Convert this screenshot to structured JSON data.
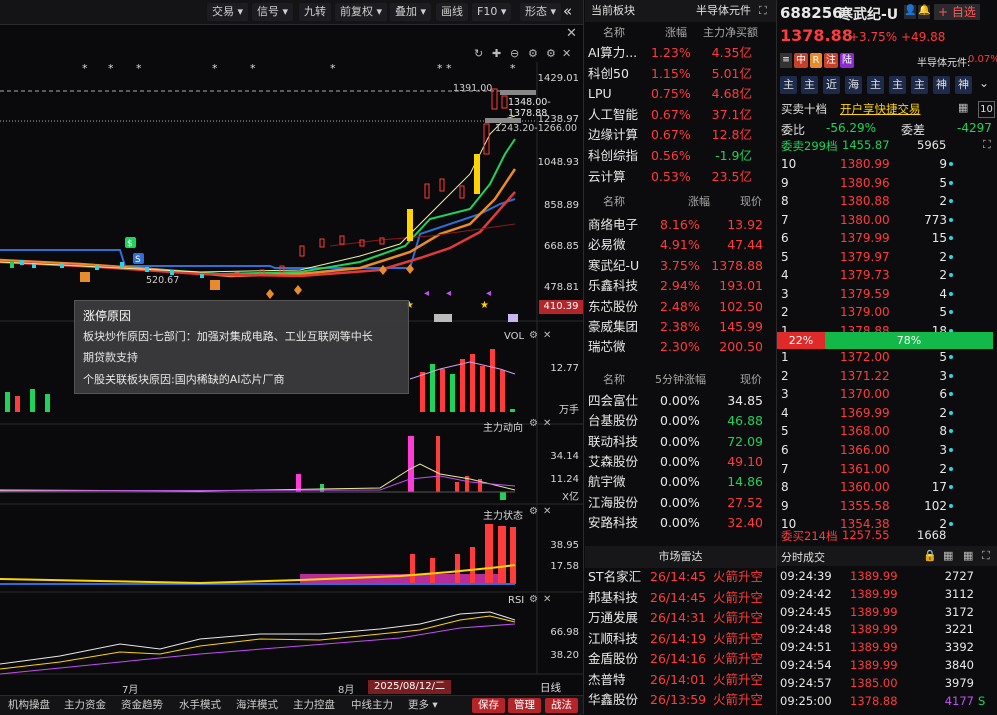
{
  "toolbar": {
    "items": [
      "交易",
      "信号",
      "九转",
      "前复权",
      "叠加",
      "画线",
      "F10",
      "形态"
    ],
    "collapse": "«"
  },
  "chart": {
    "price_axis": [
      "1429.01",
      "1348.00-1378.88",
      "1238.97",
      "1048.93",
      "858.89",
      "668.85",
      "478.81",
      "410.39"
    ],
    "annot_top": "1391.00",
    "annot_mid": "1243.20-1266.00",
    "annot_low": "520.67",
    "vol_title": "VOL",
    "vol_axis": [
      "12.77",
      "万手"
    ],
    "zldx_title": "主力动向",
    "zldx_axis": [
      "34.14",
      "11.24",
      "X亿"
    ],
    "zlzt_title": "主力状态",
    "zlzt_axis": [
      "38.95",
      "17.58"
    ],
    "rsi_title": "RSI",
    "rsi_axis": [
      "66.98",
      "38.20"
    ],
    "x_labels": [
      "7月",
      "8月"
    ],
    "date_label": "2025/08/12/二",
    "period": "日线"
  },
  "tooltip": {
    "title": "涨停原因",
    "line1": "板块炒作原因:七部门：加强对集成电路、工业互联网等中长",
    "line2": "期贷款支持",
    "line3": "个股关联板块原因:国内稀缺的AI芯片厂商"
  },
  "bottombar": {
    "items": [
      "机构操盘",
      "主力资金",
      "资金趋势",
      "水手模式",
      "海洋模式",
      "主力控盘",
      "中线主力",
      "更多"
    ],
    "save": "保存",
    "manage": "管理",
    "battle": "战法"
  },
  "sector": {
    "title": "当前板块",
    "subtitle": "半导体元件",
    "hdr1": [
      "名称",
      "涨幅",
      "主力净买额"
    ],
    "boards": [
      {
        "name": "AI算力...",
        "chg": "1.23%",
        "amt": "4.35亿",
        "amt_color": "red"
      },
      {
        "name": "科创50",
        "chg": "1.15%",
        "amt": "5.01亿",
        "amt_color": "red"
      },
      {
        "name": "LPU",
        "chg": "0.75%",
        "amt": "4.68亿",
        "amt_color": "red"
      },
      {
        "name": "人工智能",
        "chg": "0.67%",
        "amt": "37.1亿",
        "amt_color": "red"
      },
      {
        "name": "边缘计算",
        "chg": "0.67%",
        "amt": "12.8亿",
        "amt_color": "red"
      },
      {
        "name": "科创综指",
        "chg": "0.56%",
        "amt": "-1.9亿",
        "amt_color": "green"
      },
      {
        "name": "云计算",
        "chg": "0.53%",
        "amt": "23.5亿",
        "amt_color": "red"
      }
    ],
    "hdr2": [
      "名称",
      "涨幅",
      "现价"
    ],
    "stocks": [
      {
        "name": "商络电子",
        "chg": "8.16%",
        "price": "13.92"
      },
      {
        "name": "必易微",
        "chg": "4.91%",
        "price": "47.44"
      },
      {
        "name": "寒武纪-U",
        "chg": "3.75%",
        "price": "1378.88"
      },
      {
        "name": "乐鑫科技",
        "chg": "2.94%",
        "price": "193.01"
      },
      {
        "name": "东芯股份",
        "chg": "2.48%",
        "price": "102.50"
      },
      {
        "name": "豪威集团",
        "chg": "2.38%",
        "price": "145.99"
      },
      {
        "name": "瑞芯微",
        "chg": "2.30%",
        "price": "200.50"
      }
    ],
    "hdr3": [
      "名称",
      "5分钟涨幅",
      "现价"
    ],
    "fast": [
      {
        "name": "四会富仕",
        "chg": "0.00%",
        "price": "34.85",
        "pc": "white"
      },
      {
        "name": "台基股份",
        "chg": "0.00%",
        "price": "46.88",
        "pc": "green"
      },
      {
        "name": "联动科技",
        "chg": "0.00%",
        "price": "72.09",
        "pc": "green"
      },
      {
        "name": "艾森股份",
        "chg": "0.00%",
        "price": "49.10",
        "pc": "red"
      },
      {
        "name": "航宇微",
        "chg": "0.00%",
        "price": "14.86",
        "pc": "green"
      },
      {
        "name": "江海股份",
        "chg": "0.00%",
        "price": "27.52",
        "pc": "red"
      },
      {
        "name": "安路科技",
        "chg": "0.00%",
        "price": "32.40",
        "pc": "red"
      }
    ],
    "radar_title": "市场雷达",
    "radar": [
      {
        "name": "ST名家汇",
        "time": "26/14:45",
        "event": "火箭升空"
      },
      {
        "name": "邦基科技",
        "time": "26/14:45",
        "event": "火箭升空"
      },
      {
        "name": "万通发展",
        "time": "26/14:31",
        "event": "火箭升空"
      },
      {
        "name": "江顺科技",
        "time": "26/14:19",
        "event": "火箭升空"
      },
      {
        "name": "金盾股份",
        "time": "26/14:16",
        "event": "火箭升空"
      },
      {
        "name": "杰普特",
        "time": "26/14:01",
        "event": "火箭升空"
      },
      {
        "name": "华鑫股份",
        "time": "26/13:59",
        "event": "火箭升空"
      }
    ]
  },
  "stock": {
    "code": "688256",
    "name": "寒武纪-U",
    "add_watch": "+ 自选",
    "price": "1378.88",
    "chg_pct": "+3.75%",
    "chg_amt": "+49.88",
    "tags": [
      "中",
      "R",
      "注",
      "陆"
    ],
    "sector_name": "半导体元件:",
    "sector_chg": "0.07%",
    "nav": [
      "主",
      "主",
      "近",
      "海",
      "主",
      "主",
      "主",
      "神",
      "神"
    ],
    "buy10_label": "买卖十档",
    "quick_trade": "开户享快捷交易",
    "ten": "10",
    "weibi_label": "委比",
    "weibi": "-56.29%",
    "weicha_label": "委差",
    "weicha": "-4297",
    "sell_summary_label": "委卖299档",
    "sell_summary_price": "1455.87",
    "sell_summary_vol": "5965",
    "asks": [
      {
        "lvl": "10",
        "price": "1380.99",
        "vol": "9"
      },
      {
        "lvl": "9",
        "price": "1380.96",
        "vol": "5"
      },
      {
        "lvl": "8",
        "price": "1380.88",
        "vol": "2"
      },
      {
        "lvl": "7",
        "price": "1380.00",
        "vol": "773"
      },
      {
        "lvl": "6",
        "price": "1379.99",
        "vol": "15"
      },
      {
        "lvl": "5",
        "price": "1379.97",
        "vol": "2"
      },
      {
        "lvl": "4",
        "price": "1379.73",
        "vol": "2"
      },
      {
        "lvl": "3",
        "price": "1379.59",
        "vol": "4"
      },
      {
        "lvl": "2",
        "price": "1379.00",
        "vol": "5"
      },
      {
        "lvl": "1",
        "price": "1378.88",
        "vol": "18"
      }
    ],
    "ratio_sell": "22%",
    "ratio_buy": "78%",
    "ratio_sell_value": 0.22,
    "bids": [
      {
        "lvl": "1",
        "price": "1372.00",
        "vol": "5"
      },
      {
        "lvl": "2",
        "price": "1371.22",
        "vol": "3"
      },
      {
        "lvl": "3",
        "price": "1370.00",
        "vol": "6"
      },
      {
        "lvl": "4",
        "price": "1369.99",
        "vol": "2"
      },
      {
        "lvl": "5",
        "price": "1368.00",
        "vol": "8"
      },
      {
        "lvl": "6",
        "price": "1366.00",
        "vol": "3"
      },
      {
        "lvl": "7",
        "price": "1361.00",
        "vol": "2"
      },
      {
        "lvl": "8",
        "price": "1360.00",
        "vol": "17"
      },
      {
        "lvl": "9",
        "price": "1355.58",
        "vol": "102"
      },
      {
        "lvl": "10",
        "price": "1354.38",
        "vol": "2"
      }
    ],
    "buy_summary_label": "委买214档",
    "buy_summary_price": "1257.55",
    "buy_summary_vol": "1668",
    "trades_title": "分时成交",
    "trades": [
      {
        "time": "09:24:39",
        "price": "1389.99",
        "vol": "2727"
      },
      {
        "time": "09:24:42",
        "price": "1389.99",
        "vol": "3112"
      },
      {
        "time": "09:24:45",
        "price": "1389.99",
        "vol": "3172"
      },
      {
        "time": "09:24:48",
        "price": "1389.99",
        "vol": "3221"
      },
      {
        "time": "09:24:51",
        "price": "1389.99",
        "vol": "3392"
      },
      {
        "time": "09:24:54",
        "price": "1389.99",
        "vol": "3840"
      },
      {
        "time": "09:24:57",
        "price": "1385.00",
        "vol": "3979"
      },
      {
        "time": "09:25:00",
        "price": "1378.88",
        "vol": "4177",
        "flag": "S"
      }
    ]
  }
}
